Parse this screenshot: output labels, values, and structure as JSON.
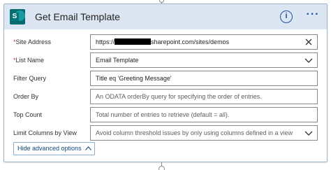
{
  "action_card": {
    "title": "Get Email Template",
    "info_icon": "info-icon",
    "more_icon": "more-options-icon",
    "brand_icon": "sharepoint-icon",
    "brand_letter": "S",
    "header_bg": "#dbe6f2",
    "accent": "#1f4fa2"
  },
  "fields": [
    {
      "label": "Site Address",
      "required": "*",
      "value_prefix": "https://",
      "value_suffix": "sharepoint.com/sites/demos",
      "control": "clear-icon"
    },
    {
      "label": "List Name",
      "required": "*",
      "value": "Email Template",
      "control": "chevron-down-icon"
    },
    {
      "label": "Filter Query",
      "value": "Title eq 'Greeting Message'"
    },
    {
      "label": "Order By",
      "placeholder": "An ODATA orderBy query for specifying the order of entries."
    },
    {
      "label": "Top Count",
      "placeholder": "Total number of entries to retrieve (default = all)."
    },
    {
      "label": "Limit Columns by View",
      "placeholder": "Avoid column threshold issues by only using columns defined in a view",
      "control": "chevron-down-icon"
    }
  ],
  "advanced": {
    "label": "Hide advanced options"
  }
}
